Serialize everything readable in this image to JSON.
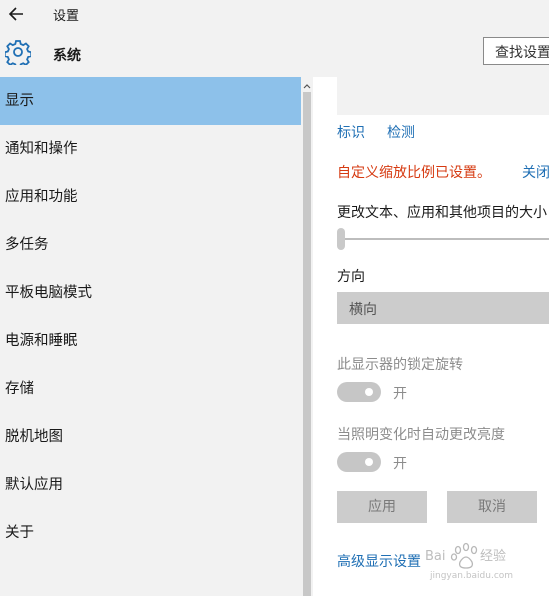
{
  "window": {
    "title": "设置"
  },
  "header": {
    "title": "系统",
    "search_placeholder": "查找设置"
  },
  "sidebar": {
    "items": [
      {
        "label": "显示",
        "selected": true
      },
      {
        "label": "通知和操作"
      },
      {
        "label": "应用和功能"
      },
      {
        "label": "多任务"
      },
      {
        "label": "平板电脑模式"
      },
      {
        "label": "电源和睡眠"
      },
      {
        "label": "存储"
      },
      {
        "label": "脱机地图"
      },
      {
        "label": "默认应用"
      },
      {
        "label": "关于"
      }
    ]
  },
  "content": {
    "identify_link": "标识",
    "detect_link": "检测",
    "custom_scaling_notice": "自定义缩放比例已设置。",
    "close_link": "关闭",
    "scale_label": "更改文本、应用和其他项目的大小",
    "scale_value_percent": 0,
    "orientation_label": "方向",
    "orientation_value": "横向",
    "rotation_lock_label": "此显示器的锁定旋转",
    "rotation_lock_state": "开",
    "auto_brightness_label": "当照明变化时自动更改亮度",
    "auto_brightness_state": "开",
    "apply_button": "应用",
    "cancel_button": "取消",
    "advanced_link": "高级显示设置"
  },
  "colors": {
    "accent": "#8dc1ea",
    "link": "#1f6fb4",
    "warning": "#d63a11",
    "sidebar_bg": "#f2f2f2"
  },
  "watermark": {
    "text": "Baidu 经验",
    "url": "jingyan.baidu.com"
  }
}
